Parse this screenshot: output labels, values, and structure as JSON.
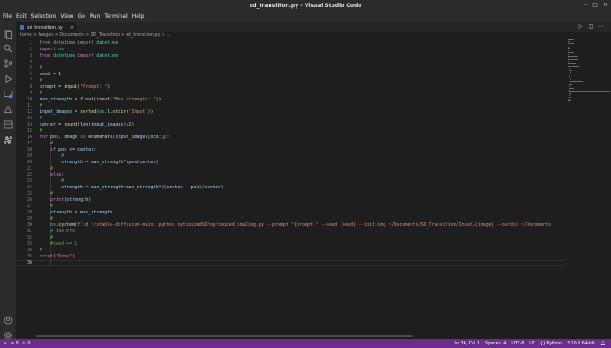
{
  "window": {
    "title": "sd_transition.py - Visual Studio Code"
  },
  "menu": [
    "File",
    "Edit",
    "Selection",
    "View",
    "Go",
    "Run",
    "Terminal",
    "Help"
  ],
  "tab": {
    "name": "sd_transition.py",
    "close": "×"
  },
  "breadcrumb": "home > faegan > Documents > SD_Transition > sd_transition.py > ...",
  "editor": {
    "lines": [
      "from datetime import datetime",
      "import os",
      "from datetime import datetime",
      "",
      "#",
      "seed = 1",
      "#",
      "prompt = input(\"Prompt: \")",
      "#",
      "max_strength = float(input(\"Max strength: \"))",
      "#",
      "input_images = sorted(os.listdir('Input'))",
      "#",
      "center = round(len(input_images)/2)",
      "#",
      "for pos, image in enumerate(input_images[858:]):",
      "    #",
      "    if pos <= center:",
      "        #",
      "        strength = max_strength*(pos/center)",
      "    #",
      "    else:",
      "        #",
      "        strength = max_strength+max_strength*((center - pos)/center)",
      "    #",
      "    print(strength)",
      "    #",
      "    strength = max_strength",
      "    #",
      "    os.system(f'cd ~/stable-diffusion-main; python optimizedSD/optimized_img2img.py --prompt \"{prompt}\" --seed {seed} --init-img ~/Documents/SD_Transition/Input/{image} --outdir ~/Documents",
      "    # 330 576",
      "    #",
      "    #seed += 1",
      "#",
      "print(\"Done\")",
      ""
    ]
  },
  "status": {
    "errors": "0",
    "warnings": "0",
    "position": "Ln 36, Col 1",
    "spaces": "Spaces: 4",
    "encoding": "UTF-8",
    "eol": "LF",
    "language": "Python",
    "interpreter": "3.10.6 64-bit"
  }
}
